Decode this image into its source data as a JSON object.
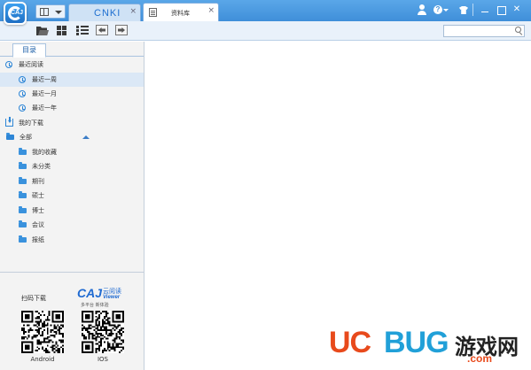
{
  "app": {
    "logo_text": "CAJ"
  },
  "tabs": [
    {
      "label": "CNKI",
      "active": false
    },
    {
      "label": "资料库",
      "active": true
    }
  ],
  "tab_close_glyph": "×",
  "window_controls": {
    "close_glyph": "✕",
    "help_glyph": "?"
  },
  "search": {
    "placeholder": "",
    "value": ""
  },
  "sidebar": {
    "tab_label": "目录",
    "recent": {
      "label": "最近阅读",
      "items": [
        {
          "label": "最近一周",
          "selected": true
        },
        {
          "label": "最近一月",
          "selected": false
        },
        {
          "label": "最近一年",
          "selected": false
        }
      ]
    },
    "downloads_label": "我的下载",
    "all": {
      "label": "全部",
      "items": [
        "我的收藏",
        "未分类",
        "期刊",
        "硕士",
        "博士",
        "会议",
        "报纸"
      ]
    }
  },
  "promo": {
    "scan_label": "扫码下载",
    "brand": "CAJ",
    "brand_cn": "云阅读",
    "brand_sub": "Viewer",
    "slogan": "多平台 新体验",
    "android_label": "Android",
    "ios_label": "IOS"
  },
  "watermark": {
    "uc": "UC",
    "bug": "BUG",
    "cn": "游戏网",
    "com": ".com"
  },
  "colors": {
    "titlebar": "#4a9ae0",
    "accent": "#2e86d6",
    "selected_row": "#dbe8f6",
    "watermark_red": "#e84a1c",
    "watermark_blue": "#21a0d8"
  }
}
